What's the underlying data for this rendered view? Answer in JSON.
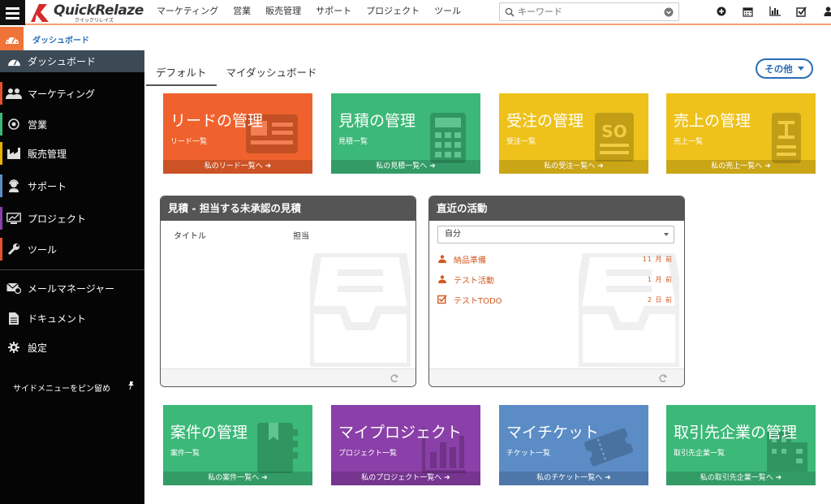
{
  "app": {
    "logo_text": "QuickRelaze",
    "logo_sub": "クイックリレイズ"
  },
  "topnav": [
    "マーケティング",
    "営業",
    "販売管理",
    "サポート",
    "プロジェクト",
    "ツール"
  ],
  "search": {
    "placeholder": "キーワード"
  },
  "topicons": [
    "plus-circle-icon",
    "calendar-icon",
    "bar-chart-icon",
    "checkbox-icon",
    "user-icon"
  ],
  "breadcrumb": {
    "label": "ダッシュボード"
  },
  "sidebar": {
    "items": [
      {
        "label": "ダッシュボード",
        "icon": "dashboard-icon",
        "color": "#f0743a"
      },
      {
        "label": "マーケティング",
        "icon": "users-icon",
        "color": "#e6502d"
      },
      {
        "label": "営業",
        "icon": "target-icon",
        "color": "#3cb878"
      },
      {
        "label": "販売管理",
        "icon": "factory-icon",
        "color": "#e8b400"
      },
      {
        "label": "サポート",
        "icon": "headset-icon",
        "color": "#5b8cc6"
      },
      {
        "label": "プロジェクト",
        "icon": "chart-icon",
        "color": "#8b3fa8"
      },
      {
        "label": "ツール",
        "icon": "wrench-icon",
        "color": "#e6502d"
      },
      {
        "label": "メールマネージャー",
        "icon": "mail-icon"
      },
      {
        "label": "ドキュメント",
        "icon": "document-icon"
      },
      {
        "label": "設定",
        "icon": "gear-icon"
      }
    ],
    "pin_label": "サイドメニューをピン留め"
  },
  "tabs": [
    "デフォルト",
    "マイダッシュボード"
  ],
  "more_button": "その他",
  "tiles_top": [
    {
      "title": "リードの管理",
      "sub": "リード一覧",
      "foot": "私のリード一覧へ",
      "color": "#f0622d"
    },
    {
      "title": "見積の管理",
      "sub": "見積一覧",
      "foot": "私の見積一覧へ",
      "color": "#3cb878"
    },
    {
      "title": "受注の管理",
      "sub": "受注一覧",
      "foot": "私の受注一覧へ",
      "color": "#eec21b"
    },
    {
      "title": "売上の管理",
      "sub": "売上一覧",
      "foot": "私の売上一覧へ",
      "color": "#eec21b"
    }
  ],
  "tiles_bottom": [
    {
      "title": "案件の管理",
      "sub": "案件一覧",
      "foot": "私の案件一覧へ",
      "color": "#3cb878"
    },
    {
      "title": "マイプロジェクト",
      "sub": "プロジェクト一覧",
      "foot": "私のプロジェクト一覧へ",
      "color": "#8b3fa8"
    },
    {
      "title": "マイチケット",
      "sub": "チケット一覧",
      "foot": "私のチケット一覧へ",
      "color": "#5b8cc6"
    },
    {
      "title": "取引先企業の管理",
      "sub": "取引先企業一覧",
      "foot": "私の取引先企業一覧へ",
      "color": "#3cb878"
    }
  ],
  "panel_quotes": {
    "title": "見積 - 担当する未承認の見積",
    "col_title": "タイトル",
    "col_owner": "担当"
  },
  "panel_activity": {
    "title": "直近の活動",
    "select_value": "自分",
    "items": [
      {
        "label": "納品準備",
        "when": "11 月 前",
        "icon": "event-icon"
      },
      {
        "label": "テスト活動",
        "when": "1 月 前",
        "icon": "event-icon"
      },
      {
        "label": "テストTODO",
        "when": "2 日 前",
        "icon": "todo-icon"
      }
    ]
  }
}
